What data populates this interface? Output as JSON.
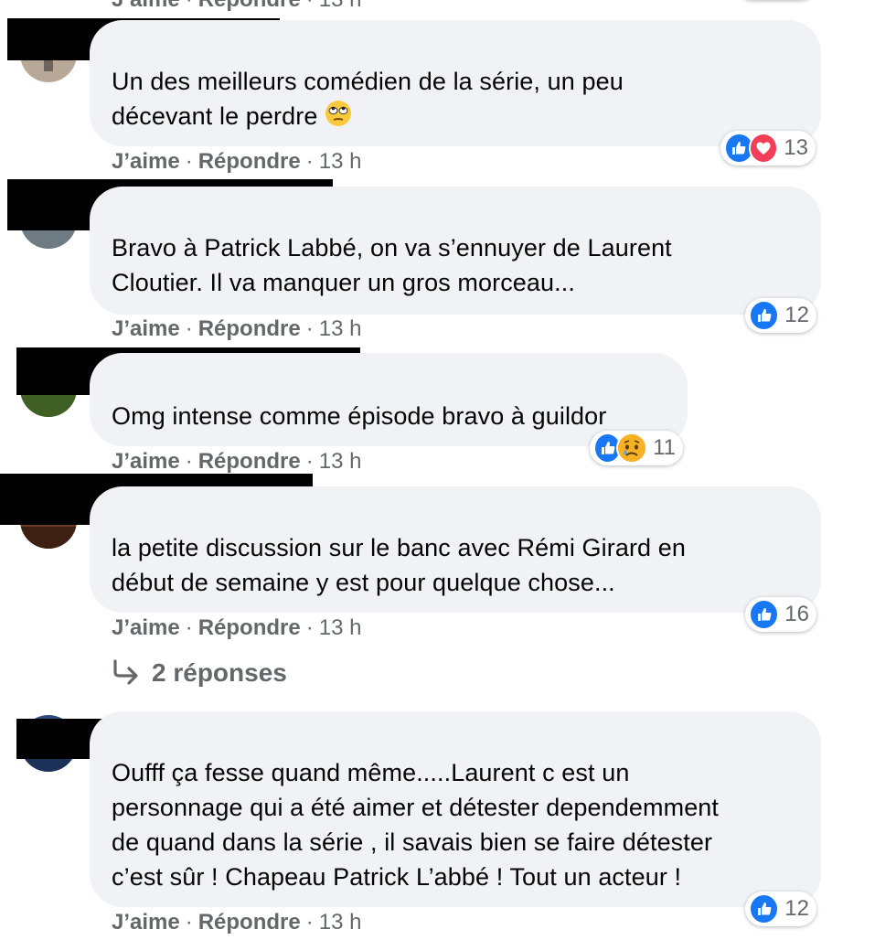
{
  "colors": {
    "bubble": "#f0f2f5",
    "secondary_text": "#65676b",
    "like_blue": "#1877f2",
    "love_red": "#f33e58",
    "sad_yellow": "#f7b125"
  },
  "top_partial": {
    "like": "J’aime",
    "reply": "Répondre",
    "time": "13 h"
  },
  "comments": [
    {
      "lines": [
        "Un des meilleurs comédien de la série, un peu",
        "décevant le perdre"
      ],
      "trailing_emoji": "eye-roll-emoji",
      "like_label": "J’aime",
      "reply_label": "Répondre",
      "time": "13 h",
      "reactions": [
        "like",
        "love"
      ],
      "reaction_count": "13"
    },
    {
      "lines": [
        "Bravo à Patrick Labbé, on va s’ennuyer de Laurent",
        "Cloutier. Il va manquer un gros morceau..."
      ],
      "like_label": "J’aime",
      "reply_label": "Répondre",
      "time": "13 h",
      "reactions": [
        "like"
      ],
      "reaction_count": "12"
    },
    {
      "lines": [
        "Omg intense comme épisode bravo à guildor"
      ],
      "like_label": "J’aime",
      "reply_label": "Répondre",
      "time": "13 h",
      "reactions": [
        "like",
        "sad"
      ],
      "reaction_count": "11"
    },
    {
      "lines": [
        "la petite discussion sur le banc avec Rémi Girard en",
        "début de semaine y est pour quelque chose..."
      ],
      "like_label": "J’aime",
      "reply_label": "Répondre",
      "time": "13 h",
      "reactions": [
        "like"
      ],
      "reaction_count": "16",
      "replies_label": "2 réponses"
    },
    {
      "lines": [
        "Oufff ça fesse quand même.....Laurent c est un",
        "personnage qui a été aimer et détester dependemment",
        "de quand dans la série , il savais bien se faire détester",
        "c’est sûr ! Chapeau Patrick L’abbé ! Tout un acteur !"
      ],
      "like_label": "J’aime",
      "reply_label": "Répondre",
      "time": "13 h",
      "reactions": [
        "like"
      ],
      "reaction_count": "12"
    }
  ]
}
